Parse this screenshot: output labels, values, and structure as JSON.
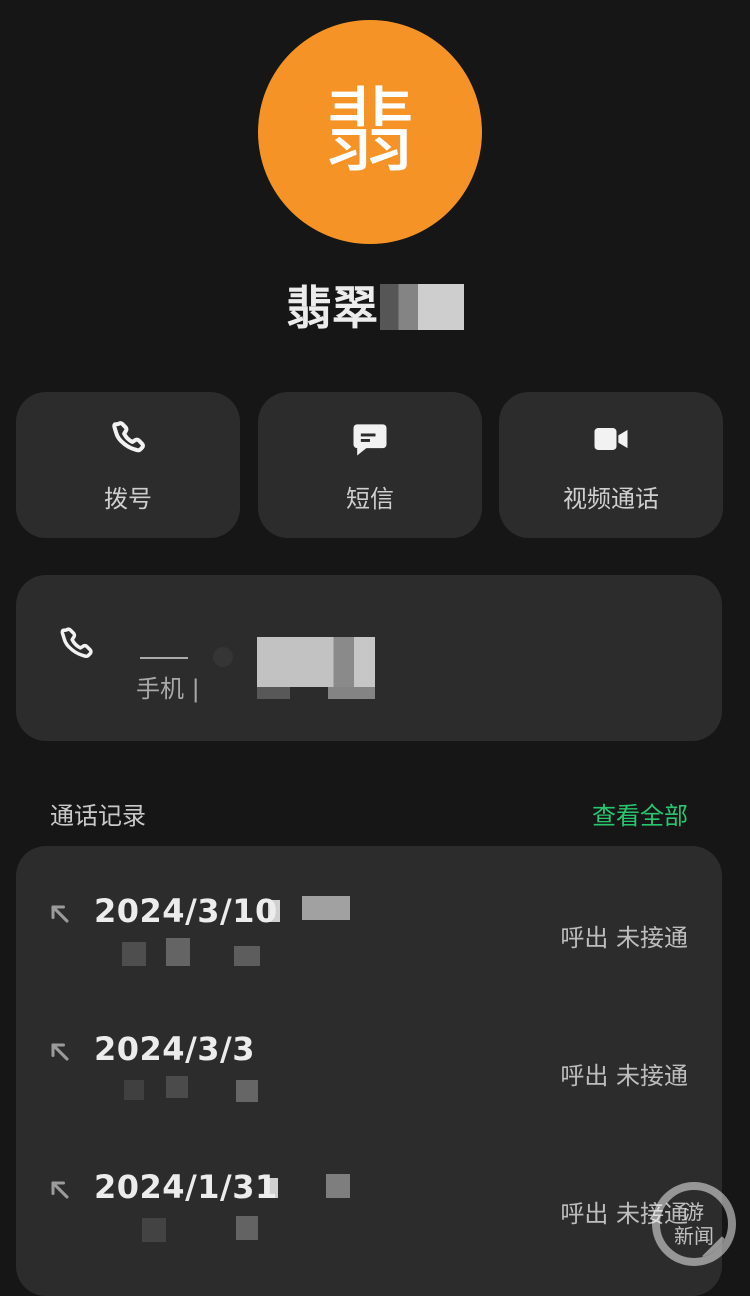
{
  "contact": {
    "avatar_char": "翡",
    "name_visible": "翡翠"
  },
  "actions": [
    {
      "label": "拨号",
      "icon": "phone-icon"
    },
    {
      "label": "短信",
      "icon": "message-icon"
    },
    {
      "label": "视频通话",
      "icon": "video-icon"
    }
  ],
  "phone": {
    "label": "手机",
    "separator": "|"
  },
  "call_log": {
    "title": "通话记录",
    "view_all": "查看全部",
    "entries": [
      {
        "date": "2024/3/10",
        "status": "呼出 未接通"
      },
      {
        "date": "2024/3/3",
        "status": "呼出 未接通"
      },
      {
        "date": "2024/1/31",
        "status": "呼出 未接通"
      }
    ]
  },
  "colors": {
    "background": "#161616",
    "card": "#2c2c2c",
    "avatar": "#f59326",
    "accent": "#28c76f"
  },
  "watermark": {
    "line1": "游",
    "line2": "新闻"
  }
}
